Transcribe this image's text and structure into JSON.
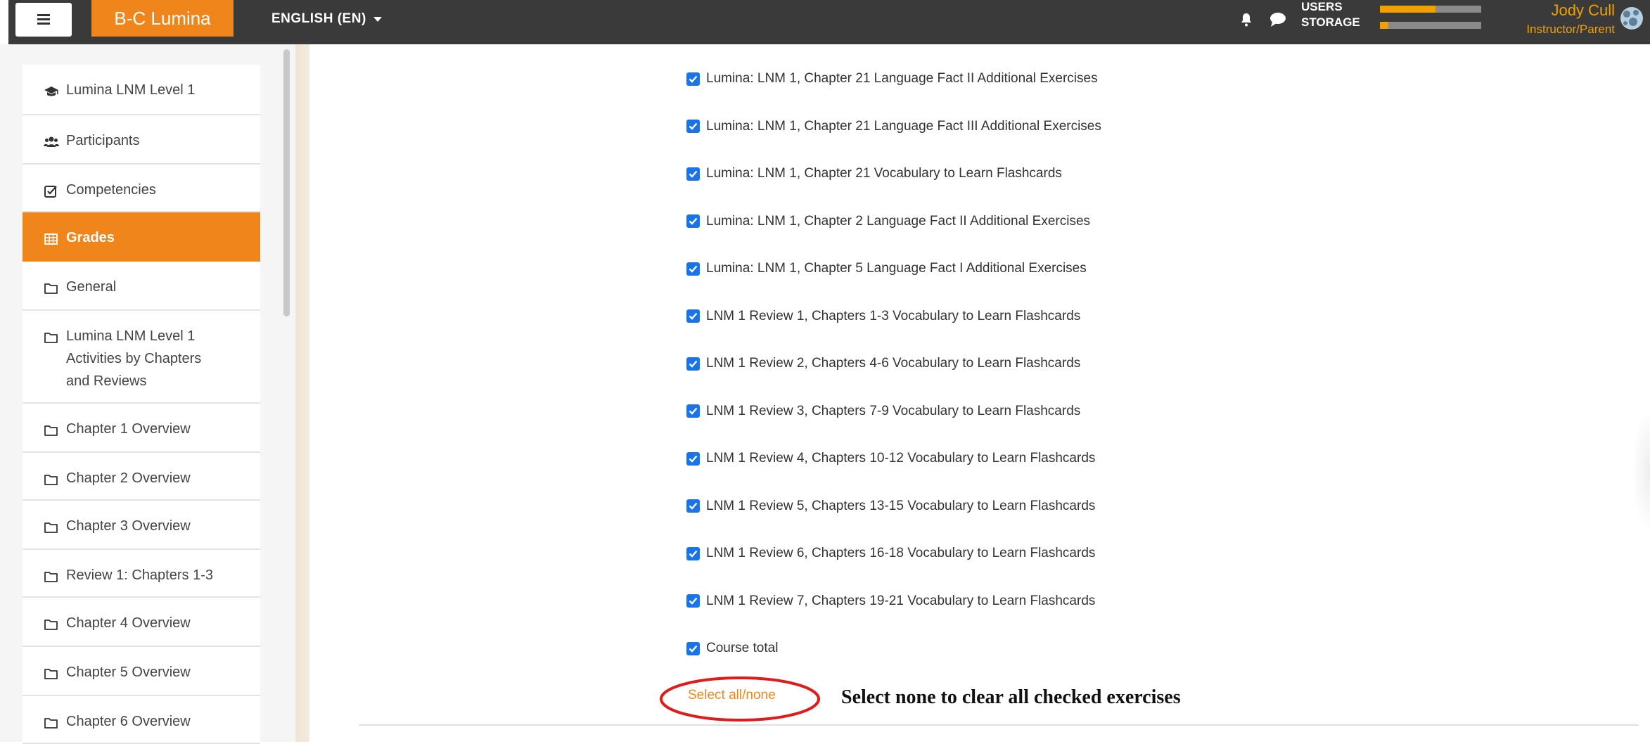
{
  "navbar": {
    "brand": "B-C Lumina",
    "language": "ENGLISH (EN)",
    "usage": {
      "users_label": "USERS",
      "storage_label": "STORAGE",
      "users_fraction": 0.55,
      "storage_fraction": 0.08
    },
    "user_name": "Jody Cull",
    "user_role": "Instructor/Parent",
    "accent": "#f0861b"
  },
  "sidebar": {
    "items": [
      {
        "label": "Lumina LNM Level 1",
        "icon": "graduation-cap-icon",
        "active": false
      },
      {
        "label": "Participants",
        "icon": "users-icon",
        "active": false
      },
      {
        "label": "Competencies",
        "icon": "checkbox-icon",
        "active": false
      },
      {
        "label": "Grades",
        "icon": "table-icon",
        "active": true
      },
      {
        "label": "General",
        "icon": "folder-icon",
        "active": false
      },
      {
        "label": "Lumina LNM Level 1\nActivities by Chapters\nand Reviews",
        "icon": "folder-icon",
        "active": false
      },
      {
        "label": "Chapter 1 Overview",
        "icon": "folder-icon",
        "active": false
      },
      {
        "label": "Chapter 2 Overview",
        "icon": "folder-icon",
        "active": false
      },
      {
        "label": "Chapter 3 Overview",
        "icon": "folder-icon",
        "active": false
      },
      {
        "label": "Review 1: Chapters 1-3",
        "icon": "folder-icon",
        "active": false
      },
      {
        "label": "Chapter 4 Overview",
        "icon": "folder-icon",
        "active": false
      },
      {
        "label": "Chapter 5 Overview",
        "icon": "folder-icon",
        "active": false
      },
      {
        "label": "Chapter 6 Overview",
        "icon": "folder-icon",
        "active": false
      }
    ]
  },
  "main": {
    "items": [
      {
        "label": "Lumina: LNM 1, Chapter 21 Language Fact II Additional Exercises",
        "checked": true
      },
      {
        "label": "Lumina: LNM 1, Chapter 21 Language Fact III Additional Exercises",
        "checked": true
      },
      {
        "label": "Lumina: LNM 1, Chapter 21 Vocabulary to Learn Flashcards",
        "checked": true
      },
      {
        "label": "Lumina: LNM 1, Chapter 2 Language Fact II Additional Exercises",
        "checked": true
      },
      {
        "label": "Lumina: LNM 1, Chapter 5 Language Fact I Additional Exercises",
        "checked": true
      },
      {
        "label": "LNM 1 Review 1, Chapters 1-3 Vocabulary to Learn Flashcards",
        "checked": true
      },
      {
        "label": "LNM 1 Review 2, Chapters 4-6 Vocabulary to Learn Flashcards",
        "checked": true
      },
      {
        "label": "LNM 1 Review 3, Chapters 7-9 Vocabulary to Learn Flashcards",
        "checked": true
      },
      {
        "label": "LNM 1 Review 4, Chapters 10-12 Vocabulary to Learn Flashcards",
        "checked": true
      },
      {
        "label": "LNM 1 Review 5, Chapters 13-15 Vocabulary to Learn Flashcards",
        "checked": true
      },
      {
        "label": "LNM 1 Review 6, Chapters 16-18 Vocabulary to Learn Flashcards",
        "checked": true
      },
      {
        "label": "LNM 1 Review 7, Chapters 19-21 Vocabulary to Learn Flashcards",
        "checked": true
      },
      {
        "label": "Course total",
        "checked": true
      }
    ],
    "select_all_label": "Select all/none",
    "annotation": "Select none to clear all checked exercises",
    "checkbox_color": "#1a73e8",
    "highlight_color": "#e01b1b"
  }
}
